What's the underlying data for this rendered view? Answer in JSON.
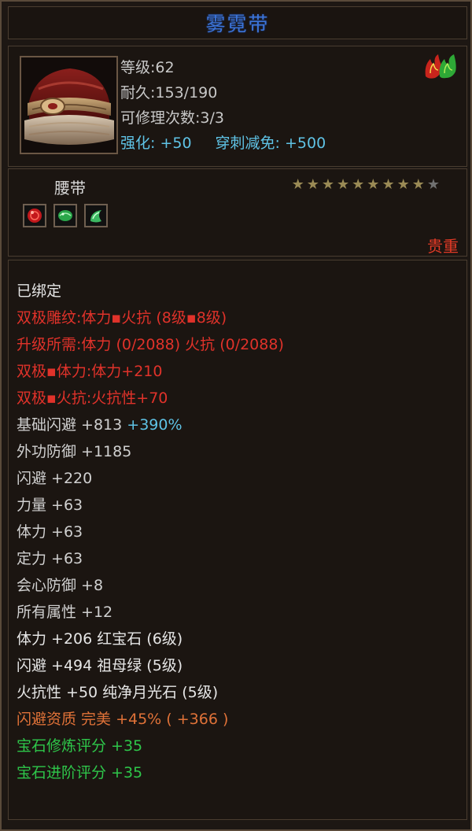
{
  "window": {
    "title": "雾霓带"
  },
  "item": {
    "level": "等级:62",
    "durability": "耐久:153/190",
    "repairs": "可修理次数:3/3",
    "enhance": "强化: +50",
    "pierce": "穿刺减免: +500",
    "badge_icon": "red-green-flame-badge",
    "type": "腰带",
    "stars_filled": 9,
    "stars_total": 10,
    "gem_slots": [
      "ruby-gem-icon",
      "emerald-gem-icon",
      "moonstone-gem-icon"
    ],
    "quality": "贵重"
  },
  "attributes": {
    "bound": "已绑定",
    "dual_engrave": "双极雕纹:体力▪火抗 (8级▪8级)",
    "upgrade_req": "升级所需:体力 (0/2088)  火抗 (0/2088)",
    "dual_vit": "双极▪体力:体力+210",
    "dual_fire": "双极▪火抗:火抗性+70",
    "base_dodge": "基础闪避 +813",
    "base_dodge_pct": "+390%",
    "ext_def": "外功防御 +1185",
    "dodge": "闪避 +220",
    "strength": "力量 +63",
    "vitality": "体力 +63",
    "focus": "定力 +63",
    "crit_def": "会心防御 +8",
    "all_attr": "所有属性 +12",
    "gem1": "体力 +206 红宝石 (6级)",
    "gem2": "闪避 +494 祖母绿 (5级)",
    "gem3": "火抗性 +50 纯净月光石 (5级)",
    "aptitude": "闪避资质  完美 +45% ( +366 )",
    "gem_refine_score": "宝石修炼评分 +35",
    "gem_advance_score": "宝石进阶评分 +35"
  },
  "colors": {
    "title_blue": "#3c74d8",
    "red": "#e0322a",
    "orange": "#e07238",
    "green": "#2ec64a",
    "cyan": "#5fc3e6"
  }
}
